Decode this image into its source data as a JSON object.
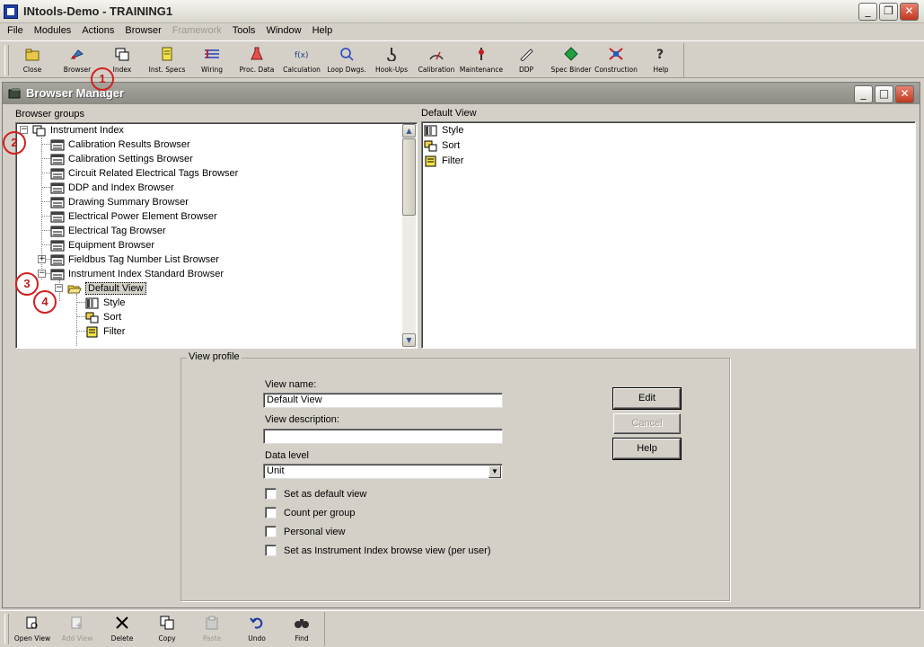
{
  "window": {
    "title": "INtools-Demo - TRAINING1"
  },
  "menu": [
    "File",
    "Modules",
    "Actions",
    "Browser",
    "Framework",
    "Tools",
    "Window",
    "Help"
  ],
  "menu_disabled": [
    "Framework"
  ],
  "toolbar": [
    {
      "label": "Close",
      "icon": "folder-close-icon"
    },
    {
      "label": "Browser",
      "icon": "browser-icon"
    },
    {
      "label": "Index",
      "icon": "index-icon"
    },
    {
      "label": "Inst. Specs",
      "icon": "spec-sheet-icon"
    },
    {
      "label": "Wiring",
      "icon": "wiring-icon"
    },
    {
      "label": "Proc. Data",
      "icon": "flask-icon"
    },
    {
      "label": "Calculation",
      "icon": "calculation-icon"
    },
    {
      "label": "Loop Dwgs.",
      "icon": "loop-drawing-icon"
    },
    {
      "label": "Hook-Ups",
      "icon": "hookup-icon"
    },
    {
      "label": "Calibration",
      "icon": "calibration-icon"
    },
    {
      "label": "Maintenance",
      "icon": "maintenance-icon"
    },
    {
      "label": "DDP",
      "icon": "pencil-icon"
    },
    {
      "label": "Spec Binder",
      "icon": "binder-icon"
    },
    {
      "label": "Construction",
      "icon": "construction-icon"
    },
    {
      "label": "Help",
      "icon": "help-icon"
    }
  ],
  "child_window": {
    "title": "Browser Manager"
  },
  "browser_groups": {
    "label": "Browser groups",
    "root": "Instrument Index",
    "items": [
      "Calibration Results Browser",
      "Calibration Settings Browser",
      "Circuit Related Electrical Tags Browser",
      "DDP and Index Browser",
      "Drawing Summary Browser",
      "Electrical Power Element Browser",
      "Electrical Tag Browser",
      "Equipment Browser",
      "Fieldbus Tag Number List Browser",
      "Instrument Index Standard Browser"
    ],
    "selected_view": "Default View",
    "view_children": [
      "Style",
      "Sort",
      "Filter"
    ]
  },
  "default_view": {
    "label": "Default View",
    "items": [
      "Style",
      "Sort",
      "Filter"
    ]
  },
  "view_profile": {
    "title": "View profile",
    "view_name_label": "View name:",
    "view_name_value": "Default View",
    "view_description_label": "View description:",
    "view_description_value": "",
    "data_level_label": "Data level",
    "data_level_value": "Unit",
    "checkboxes": [
      "Set as default view",
      "Count per group",
      "Personal view",
      "Set as Instrument Index browse view (per user)"
    ],
    "edit": "Edit",
    "cancel": "Cancel",
    "help": "Help"
  },
  "bottom_toolbar": [
    {
      "label": "Open View",
      "icon": "open-view-icon",
      "enabled": true
    },
    {
      "label": "Add View",
      "icon": "add-view-icon",
      "enabled": false
    },
    {
      "label": "Delete",
      "icon": "delete-icon",
      "enabled": true
    },
    {
      "label": "Copy",
      "icon": "copy-icon",
      "enabled": true
    },
    {
      "label": "Paste",
      "icon": "paste-icon",
      "enabled": false
    },
    {
      "label": "Undo",
      "icon": "undo-icon",
      "enabled": true
    },
    {
      "label": "Find",
      "icon": "find-icon",
      "enabled": true
    }
  ],
  "annotations": [
    "1",
    "2",
    "3",
    "4"
  ],
  "colors": {
    "annotation": "#d12020",
    "selection": "#d4d0c8"
  }
}
